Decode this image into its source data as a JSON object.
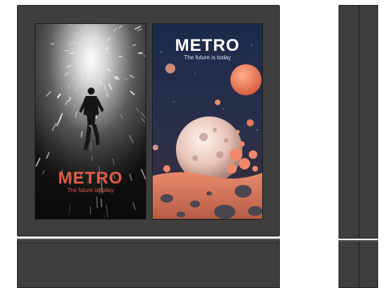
{
  "left_screen": {
    "brand": "METRO",
    "tagline": "The future is today",
    "brand_color": "#e35d48"
  },
  "right_screen": {
    "brand": "METRO",
    "tagline": "The future is today",
    "brand_color": "#ffffff"
  },
  "colors": {
    "cabinet": "#3e3e3e",
    "cabinet_edge": "#222222",
    "space_sky": "#1a2135",
    "planet_surface": "#e88a6c"
  },
  "icons": [
    "running-man-tunnel-artwork",
    "space-planet-artwork"
  ]
}
